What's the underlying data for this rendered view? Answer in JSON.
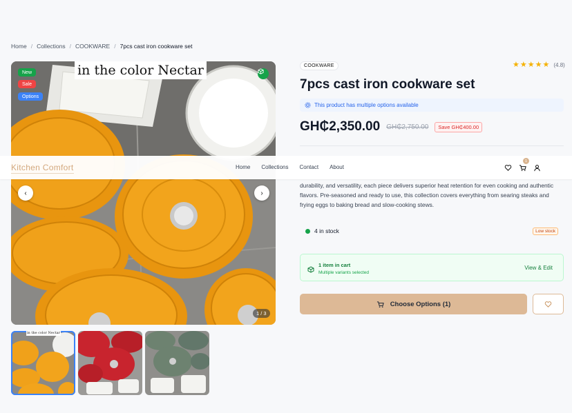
{
  "breadcrumb": {
    "home": "Home",
    "collections": "Collections",
    "category": "COOKWARE",
    "current": "7pcs cast iron cookware set",
    "separator": "/"
  },
  "gallery": {
    "caption": "in the color Nectar",
    "badges": {
      "new": "New",
      "sale": "Sale",
      "options": "Options"
    },
    "counter": "1 / 3",
    "thumb_caption": "in the color Nectar",
    "colors": [
      "#f0a11a",
      "#c8242e",
      "#6d8270"
    ]
  },
  "header": {
    "logo": "Kitchen Comfort",
    "nav": {
      "home": "Home",
      "collections": "Collections",
      "contact": "Contact",
      "about": "About"
    },
    "cart_count": "1"
  },
  "product": {
    "category": "COOKWARE",
    "rating_count": "(4.8)",
    "rating": 5,
    "title": "7pcs cast iron cookware set",
    "options_note": "This product has multiple options available",
    "price": "GH₵2,350.00",
    "old_price": "GH₵2,750.00",
    "save": "Save GH₵400.00",
    "description": "durability, and versatility, each piece delivers superior heat retention for even cooking and authentic flavors. Pre-seasoned and ready to use, this collection covers everything from searing steaks and frying eggs to baking bread and slow-cooking stews.",
    "stock": "4 in stock",
    "low_stock": "Low stock"
  },
  "cart": {
    "title": "1 item in cart",
    "subtitle": "Multiple variants selected",
    "view_edit": "View & Edit"
  },
  "actions": {
    "choose": "Choose Options (1)"
  },
  "icons": {
    "cube": "cube-icon",
    "star": "star-icon",
    "heart": "heart-icon",
    "cart": "cart-icon",
    "user": "user-icon",
    "settings": "gear-icon"
  },
  "accent": "#ddb996"
}
